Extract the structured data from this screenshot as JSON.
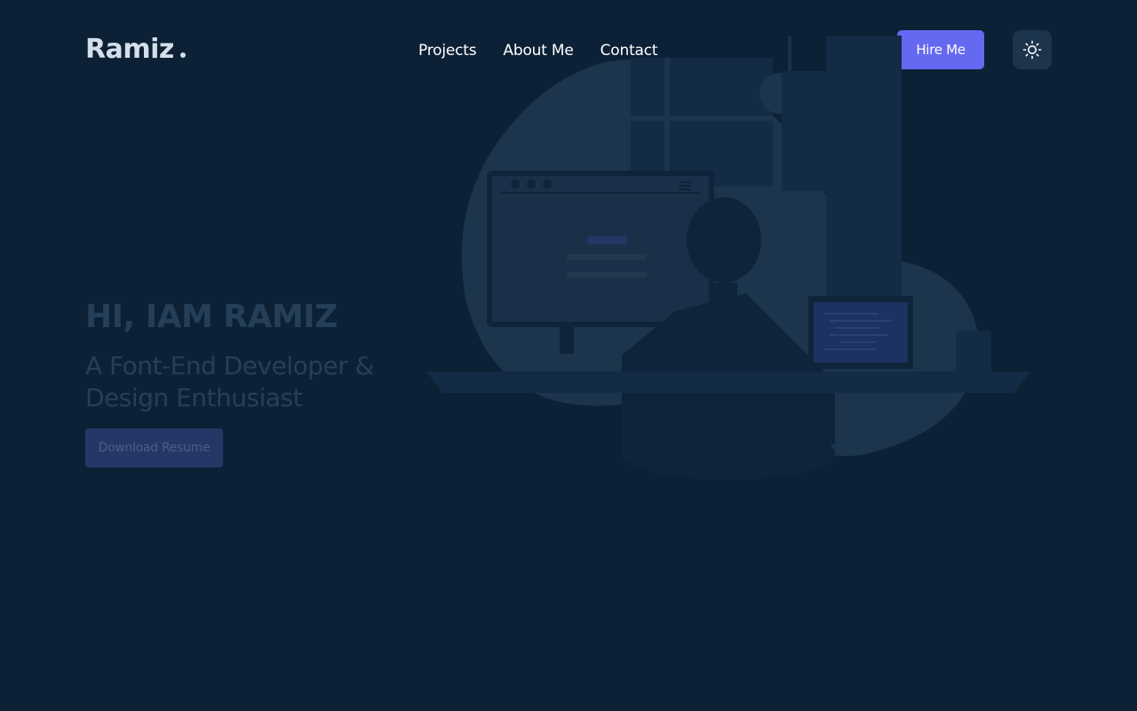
{
  "header": {
    "logo_text": "Ramiz",
    "nav": [
      {
        "label": "Projects"
      },
      {
        "label": "About Me"
      },
      {
        "label": "Contact"
      }
    ],
    "hire_label": "Hire Me",
    "theme_icon": "sun-icon"
  },
  "hero": {
    "title": "HI, IAM RAMIZ",
    "subtitle": "A Font-End Developer & Design Enthusiast",
    "resume_label": "Download Resume"
  },
  "colors": {
    "background": "#0c2136",
    "accent": "#6568f1",
    "muted_text": "#263f58",
    "illustration": "#1d344d"
  }
}
